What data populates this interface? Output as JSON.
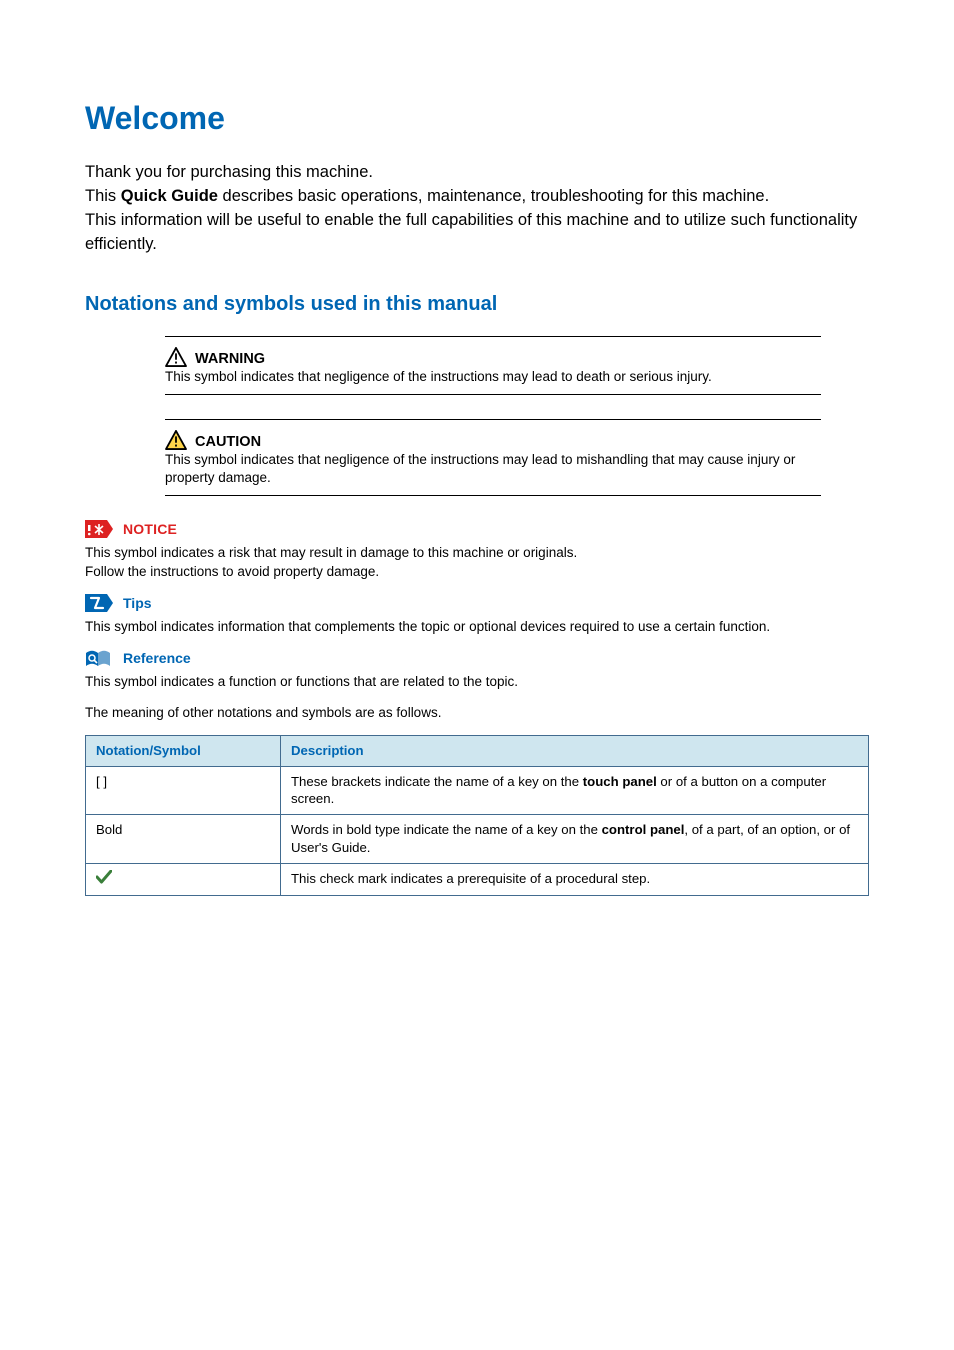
{
  "title": "Welcome",
  "intro": {
    "line1": "Thank you for purchasing this machine.",
    "line2a": "This ",
    "quick_guide": "Quick Guide",
    "line2b": " describes basic operations, maintenance, troubleshooting for this machine.",
    "line3": "This information will be useful to enable the full capabilities of this machine and to utilize such functionality efficiently."
  },
  "section_heading": "Notations and symbols used in this manual",
  "warning": {
    "label": "WARNING",
    "text": "This symbol indicates that negligence of the instructions may lead to death or serious injury."
  },
  "caution": {
    "label": "CAUTION",
    "text": "This symbol indicates that negligence of the instructions may lead to mishandling that may cause injury or property damage."
  },
  "notice": {
    "label": "NOTICE",
    "text1": "This symbol indicates a risk that may result in damage to this machine or originals.",
    "text2": "Follow the instructions to avoid property damage."
  },
  "tips": {
    "label": "Tips",
    "text": "This symbol indicates information that complements the topic or optional devices required to use a certain function."
  },
  "reference": {
    "label": "Reference",
    "text": "This symbol indicates a function or functions that are related to the topic."
  },
  "other_note": "The meaning of other notations and symbols are as follows.",
  "table": {
    "head_col1": "Notation/Symbol",
    "head_col2": "Description",
    "rows": [
      {
        "symbol": "[ ]",
        "desc_a": "These brackets indicate the name of a key on the ",
        "desc_bold": "touch panel",
        "desc_b": " or of a button on a computer screen."
      },
      {
        "symbol": "Bold",
        "desc_a": "Words in bold type indicate the name of a key on the ",
        "desc_bold": "control panel",
        "desc_b": ", of a part, of an option, or of User's Guide."
      },
      {
        "symbol": "__check__",
        "desc_a": "This check mark indicates a prerequisite of a procedural step.",
        "desc_bold": "",
        "desc_b": ""
      }
    ]
  }
}
